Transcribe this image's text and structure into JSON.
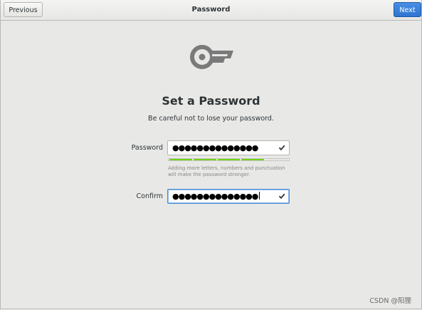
{
  "header": {
    "title": "Password",
    "previous_label": "Previous",
    "next_label": "Next"
  },
  "icon": "key-icon",
  "main": {
    "heading": "Set a Password",
    "subtitle": "Be careful not to lose your password."
  },
  "password_field": {
    "label": "Password",
    "masked_value": "●●●●●●●●●●●●●●",
    "valid_icon": "check-icon",
    "strength_fraction": 0.8,
    "hint": "Adding more letters, numbers and punctuation will make the password stronger."
  },
  "confirm_field": {
    "label": "Confirm",
    "masked_value": "●●●●●●●●●●●●●●",
    "valid_icon": "check-icon"
  },
  "watermark": "CSDN @阳狸",
  "colors": {
    "accent": "#3584e4",
    "strength": "#73d216",
    "icon_grey": "#7a7a7a"
  }
}
